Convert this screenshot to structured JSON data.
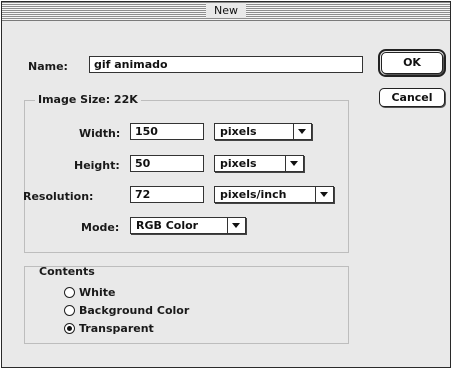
{
  "window": {
    "title": "New"
  },
  "name": {
    "label": "Name:",
    "value": "gif animado"
  },
  "buttons": {
    "ok": "OK",
    "cancel": "Cancel"
  },
  "image_size": {
    "title": "Image Size: 22K",
    "width": {
      "label": "Width:",
      "value": "150",
      "unit": "pixels"
    },
    "height": {
      "label": "Height:",
      "value": "50",
      "unit": "pixels"
    },
    "resolution": {
      "label": "Resolution:",
      "value": "72",
      "unit": "pixels/inch"
    },
    "mode": {
      "label": "Mode:",
      "value": "RGB Color"
    }
  },
  "contents": {
    "title": "Contents",
    "options": [
      {
        "label": "White",
        "selected": false
      },
      {
        "label": "Background Color",
        "selected": false
      },
      {
        "label": "Transparent",
        "selected": true
      }
    ]
  }
}
